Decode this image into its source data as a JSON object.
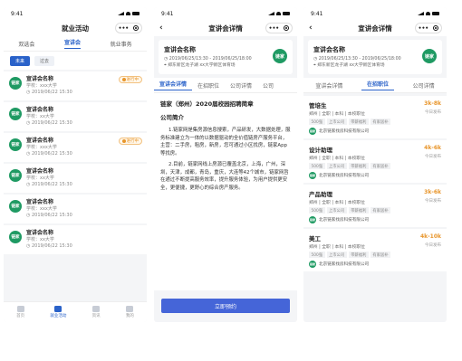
{
  "status_time": "9:41",
  "brand_color": "#2a62c9",
  "logo_text": "链家",
  "screen1": {
    "title": "就业活动",
    "tabs": [
      "双选会",
      "宣讲会",
      "就业事务"
    ],
    "segments": [
      "未来",
      "过去"
    ],
    "badge_text": "进行中",
    "cards": [
      {
        "title": "宣讲会名称",
        "school": "学校：xxx大学",
        "time": "2019/06/22 15:30",
        "badge": true
      },
      {
        "title": "宣讲会名称",
        "school": "学校：xx大学",
        "time": "2019/06/22 15:30",
        "badge": false
      },
      {
        "title": "宣讲会名称",
        "school": "学校：xxx大学",
        "time": "2019/06/22 15:30",
        "badge": true
      },
      {
        "title": "宣讲会名称",
        "school": "学校：xx大学",
        "time": "2019/06/22 15:30",
        "badge": false
      },
      {
        "title": "宣讲会名称",
        "school": "学校：xxx大学",
        "time": "2019/06/22 15:30",
        "badge": false
      },
      {
        "title": "宣讲会名称",
        "school": "学校：xx大学",
        "time": "2019/06/22 15:30",
        "badge": false
      }
    ],
    "tabbar": [
      "首页",
      "就业活动",
      "资讯",
      "我的"
    ]
  },
  "screen2": {
    "title": "宣讲会详情",
    "card_title": "宣讲会名称",
    "card_time": "2019/06/25/13:30 - 2019/06/25/18:00",
    "card_place": "郑东新区龙子湖 xx大学新区体育场",
    "tabs": [
      "宣讲会详情",
      "在招职位",
      "公司详情",
      "公司"
    ],
    "heading": "链家（郑州）2020届校园招聘简章",
    "intro_title": "公司简介",
    "para1": "1.链家网是集房源信息搜索，产品研发，大数据处理，服务标准建立为一体的以数据驱动的全价值链房产服务平台，主营：二手房，租房，新房，您可通过小区找房，链家App等找房。",
    "para2": "2.目前，链家网线上房源已覆盖北京，上海，广州，深圳，天津，成都，青岛，重庆，大连等42个城市，链家网旨在通过不断提高服务效率，提升服务体验，为用户提供更安全，更便捷，更舒心的综合房产服务。",
    "button": "立即预约"
  },
  "screen3": {
    "title": "宣讲会详情",
    "card_title": "宣讲会名称",
    "card_time": "2019/06/25/13:30 - 2019/06/25/18:00",
    "card_place": "郑东新区龙子湖 xx大学新区体育场",
    "tabs": [
      "宣讲会详情",
      "在招职位",
      "公司详情"
    ],
    "company": "北京链家找房科技有限公司",
    "pub": "今日发布",
    "jobs": [
      {
        "title": "管培生",
        "meta": "郑州 | 全职 | 本科 | 本校职位",
        "salary": "3k-8k",
        "tags": [
          "500强",
          "上市公司",
          "带薪福利",
          "有家居补"
        ]
      },
      {
        "title": "设计助理",
        "meta": "郑州 | 全职 | 本科 | 本校职位",
        "salary": "4k-6k",
        "tags": [
          "500强",
          "上市公司",
          "带薪福利",
          "有家居补"
        ]
      },
      {
        "title": "产品助理",
        "meta": "郑州 | 全职 | 本科 | 本校职位",
        "salary": "3k-6k",
        "tags": [
          "500强",
          "上市公司",
          "带薪福利",
          "有家居补"
        ]
      },
      {
        "title": "美工",
        "meta": "郑州 | 全职 | 本科 | 本校职位",
        "salary": "4k-10k",
        "tags": [
          "500强",
          "上市公司",
          "带薪福利",
          "有家居补"
        ]
      }
    ]
  }
}
